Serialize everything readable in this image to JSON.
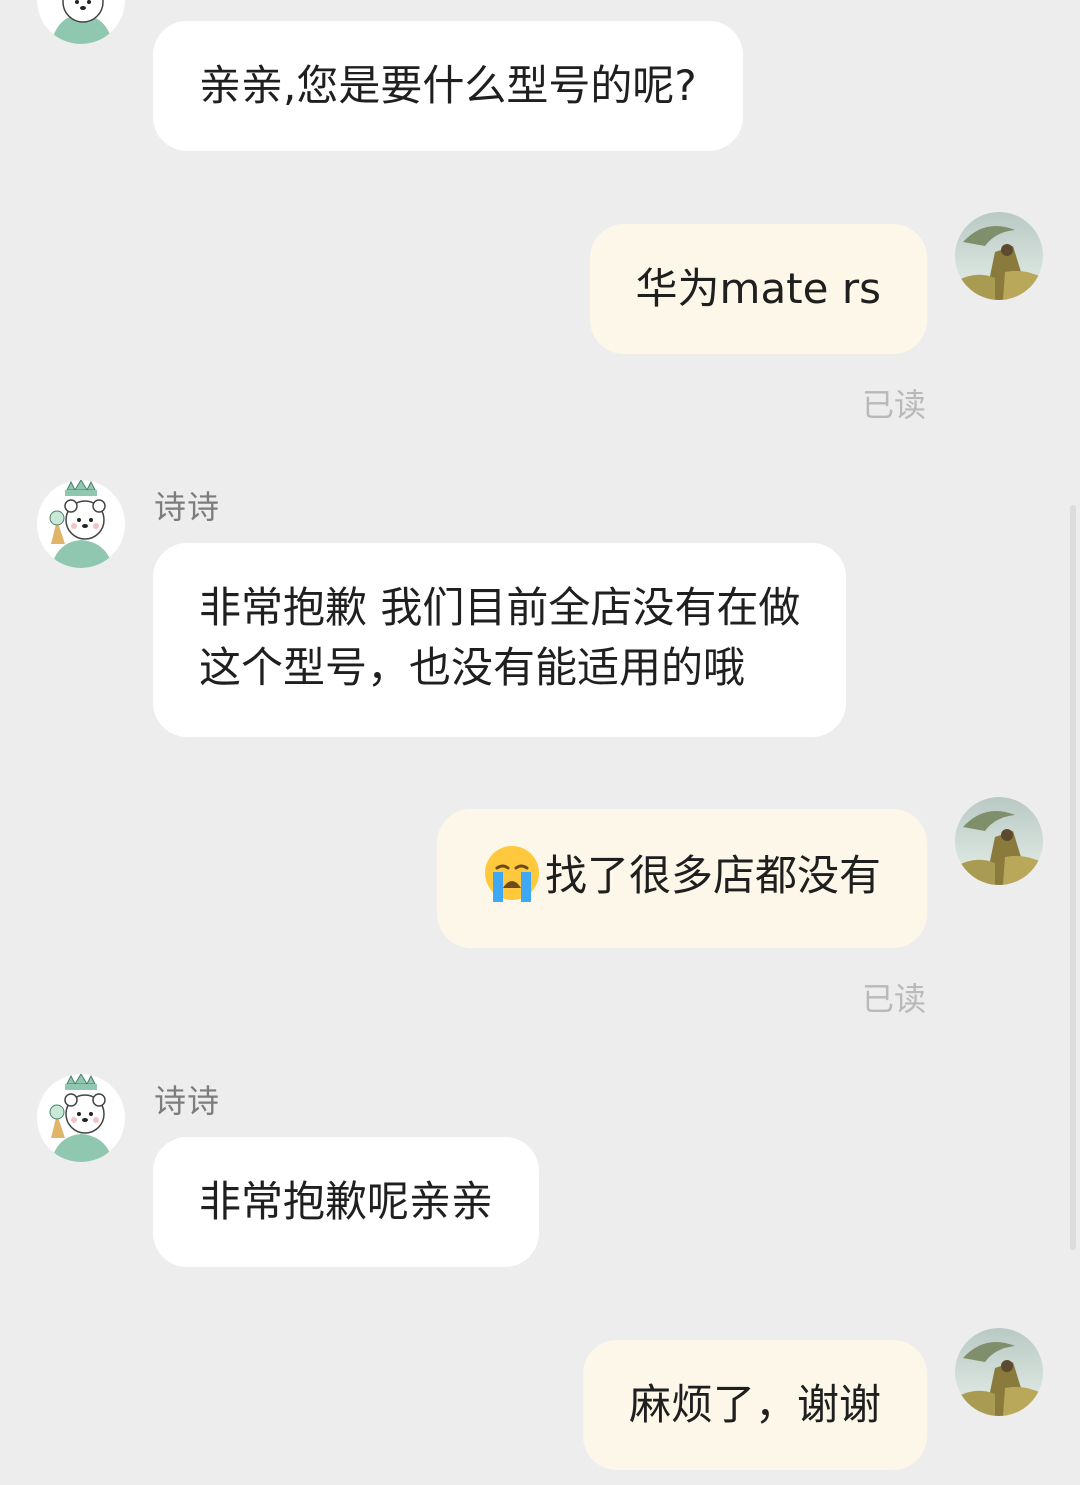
{
  "contact": {
    "name": "诗诗"
  },
  "messages": [
    {
      "side": "in",
      "text": "亲亲,您是要什么型号的呢?"
    },
    {
      "side": "out",
      "text": "华为mate rs",
      "status": "已读"
    },
    {
      "side": "in",
      "sender": "诗诗",
      "lines": [
        "非常抱歉 我们目前全店没有在做",
        "这个型号，也没有能适用的哦"
      ]
    },
    {
      "side": "out",
      "emoji": "loudly-crying-face",
      "text": "找了很多店都没有",
      "status": "已读"
    },
    {
      "side": "in",
      "sender": "诗诗",
      "text": "非常抱歉呢亲亲"
    },
    {
      "side": "out",
      "text": "麻烦了，谢谢"
    }
  ],
  "colors": {
    "background": "#ededed",
    "incoming_bubble": "#ffffff",
    "outgoing_bubble": "#fdf7e9",
    "read_status": "#b9b9b9"
  }
}
